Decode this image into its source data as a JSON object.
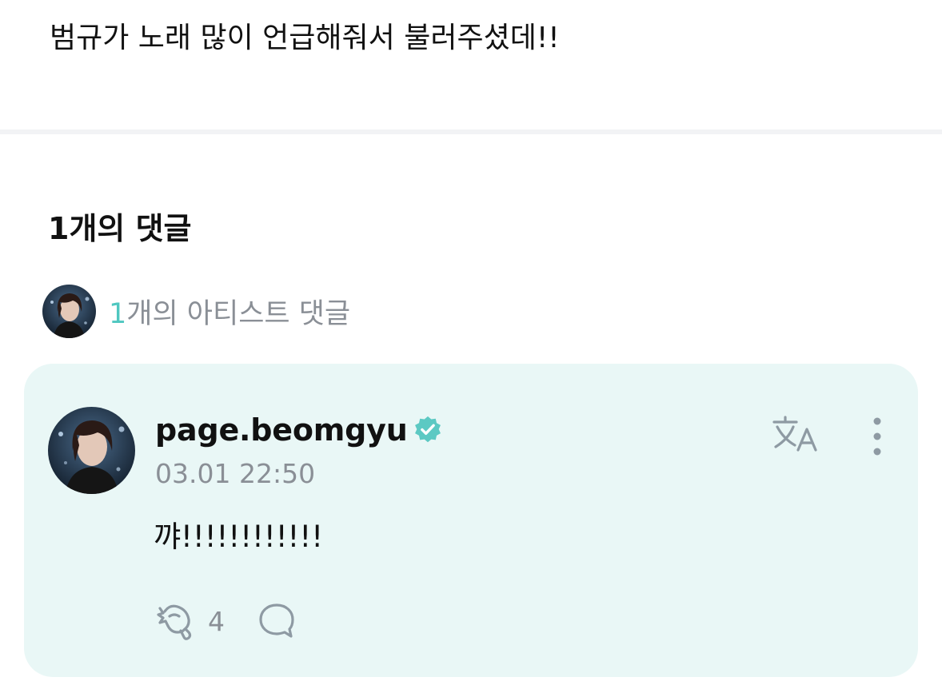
{
  "post": {
    "text": "범규가 노래 많이 언급해줘서 불러주셨데!!"
  },
  "comments_section": {
    "count_label": "1개의 댓글",
    "artist_comments": {
      "count": "1",
      "label": "개의 아티스트 댓글"
    }
  },
  "comment": {
    "username": "page.beomgyu",
    "verified": true,
    "timestamp": "03.01 22:50",
    "body": "꺄!!!!!!!!!!!!",
    "reaction_count": "4"
  },
  "icons": {
    "verified": "verified-badge-icon",
    "translate": "translate-icon",
    "more": "more-vertical-icon",
    "reaction": "reaction-hand-icon",
    "reply": "reply-bubble-icon"
  },
  "colors": {
    "accent": "#4fc7c0",
    "card_background": "#e9f7f6",
    "muted_text": "#8a8f96",
    "icon_gray": "#8e9aa3"
  }
}
